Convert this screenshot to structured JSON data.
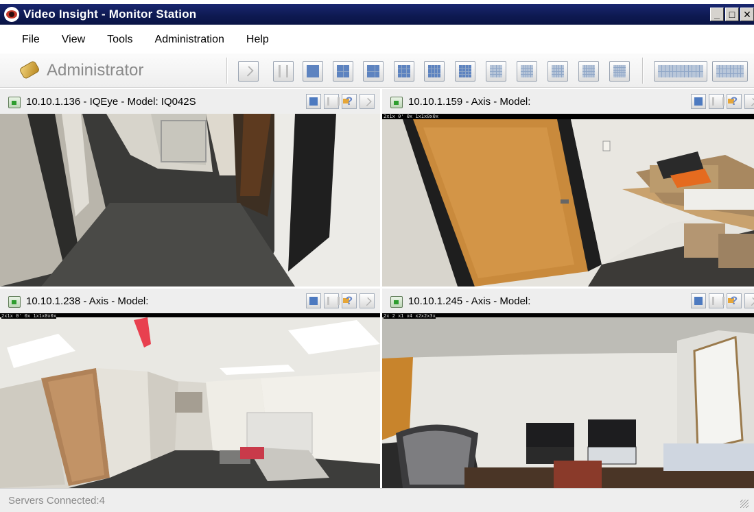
{
  "window": {
    "title": "Video Insight - Monitor Station",
    "controls": [
      "minimize",
      "maximize",
      "close"
    ],
    "control_glyphs": {
      "minimize": "_",
      "maximize": "□",
      "close": "✕"
    }
  },
  "menu": {
    "items": [
      {
        "label": "File"
      },
      {
        "label": "View"
      },
      {
        "label": "Tools"
      },
      {
        "label": "Administration"
      },
      {
        "label": "Help"
      }
    ]
  },
  "toolbar": {
    "user_label": "Administrator",
    "user_icon": "key-icon",
    "layout_buttons": [
      {
        "name": "ptz-layout-button",
        "icon": "ptz-icon"
      },
      {
        "name": "split-layout-button",
        "icon": "split-icon"
      },
      {
        "name": "layout-1x1-button",
        "icon": "grid-icon"
      },
      {
        "name": "layout-2x2-button",
        "icon": "grid-icon"
      },
      {
        "name": "layout-1plus5-button",
        "icon": "grid-icon"
      },
      {
        "name": "layout-3x3-button",
        "icon": "grid-icon"
      },
      {
        "name": "layout-1plus7-button",
        "icon": "grid-icon"
      },
      {
        "name": "layout-4x4-button",
        "icon": "grid-icon"
      },
      {
        "name": "layout-1plus12-button",
        "icon": "grid-icon"
      },
      {
        "name": "layout-5x5-button",
        "icon": "grid-icon"
      },
      {
        "name": "layout-1plus9-button",
        "icon": "grid-icon"
      },
      {
        "name": "layout-6x6-button",
        "icon": "grid-icon"
      },
      {
        "name": "layout-7x7-button",
        "icon": "grid-icon"
      },
      {
        "name": "layout-wide-1-button",
        "icon": "grid-icon"
      },
      {
        "name": "layout-wide-2-button",
        "icon": "grid-icon"
      }
    ]
  },
  "cameras": [
    {
      "title": "10.10.1.136 - IQEye - Model: IQ042S",
      "scene": "hallway-corridor",
      "osd": ""
    },
    {
      "title": "10.10.1.159 - Axis - Model:",
      "scene": "office-door",
      "osd": "2x1x 0' 0x 1x1x0x0x"
    },
    {
      "title": "10.10.1.238 - Axis - Model:",
      "scene": "office-hallway",
      "osd": "2x1x 0' 0x 1x1x0x0x"
    },
    {
      "title": "10.10.1.245 - Axis - Model:",
      "scene": "office-desks",
      "osd": "2x 2 x1 x4 x2x2x3x"
    }
  ],
  "colors": {
    "titlebar": "#0e1a52",
    "grid_blue": "#5d83c0",
    "status_text": "#8a8a8a"
  },
  "status": {
    "text": "Servers Connected:4"
  }
}
